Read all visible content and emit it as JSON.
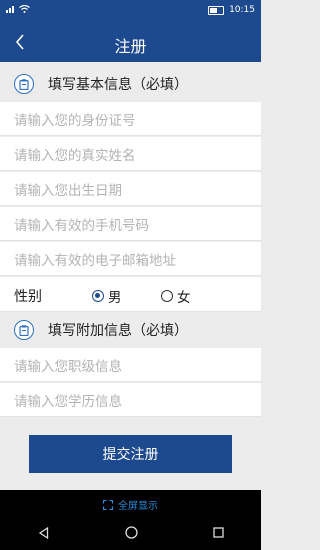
{
  "status_bar": {
    "time": "10:15"
  },
  "header": {
    "title": "注册"
  },
  "sections": {
    "basic": {
      "title": "填写基本信息（必填）"
    },
    "extra": {
      "title": "填写附加信息（必填）"
    }
  },
  "fields": {
    "id_number": "请输入您的身份证号",
    "real_name": "请输入您的真实姓名",
    "birth_date": "请输入您出生日期",
    "phone": "请输入有效的手机号码",
    "email": "请输入有效的电子邮箱地址",
    "job_level": "请输入您职级信息",
    "education": "请输入您学历信息"
  },
  "gender": {
    "label": "性别",
    "options": [
      "男",
      "女"
    ],
    "selected": "男"
  },
  "submit": {
    "label": "提交注册"
  },
  "bottom": {
    "fullscreen_label": "全屏显示"
  },
  "colors": {
    "primary": "#1d4a8e",
    "accent": "#2d6fc4",
    "link": "#2a8de0"
  },
  "icons": [
    "signal-icon",
    "wifi-icon",
    "battery-icon",
    "back-arrow-icon",
    "clipboard-icon",
    "fullscreen-icon",
    "nav-back-icon",
    "nav-home-icon",
    "nav-recent-icon"
  ]
}
